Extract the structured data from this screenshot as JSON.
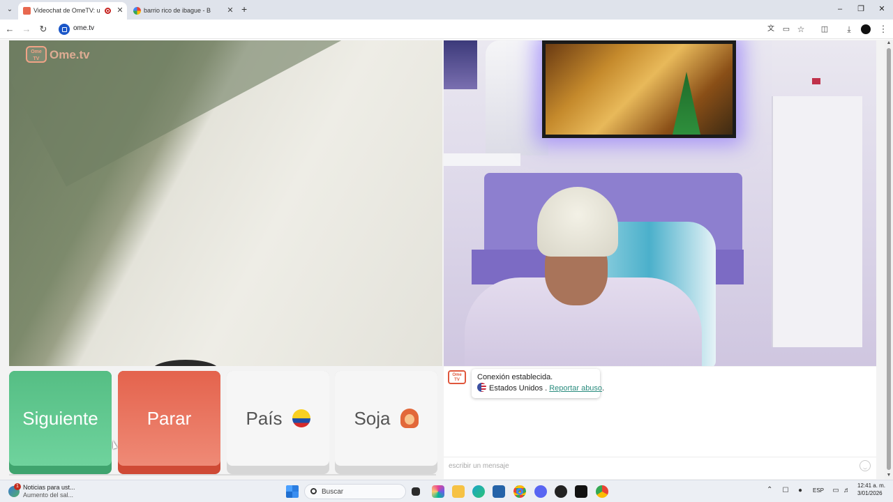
{
  "browser": {
    "tabs": [
      {
        "title": "Videochat de OmeTV: una",
        "active": true
      },
      {
        "title": "barrio rico de ibague - Buscar c",
        "active": false
      }
    ],
    "url": "ome.tv"
  },
  "page": {
    "logo_text": "Ome.tv",
    "logo_badge": "Ome TV",
    "buttons": {
      "next": "Siguiente",
      "stop": "Parar",
      "country": "País",
      "gender": "Soja"
    },
    "chat": {
      "system_icon_text": "Ome TV",
      "connection_status": "Conexión establecida.",
      "partner_country": "Estados Unidos .",
      "report_link": "Reportar abuso",
      "report_suffix": ".",
      "input_placeholder": "escribir un mensaje"
    }
  },
  "taskbar": {
    "news_title": "Noticias para ust...",
    "news_subtitle": "Aumento del sal...",
    "news_badge": "1",
    "search_placeholder": "Buscar",
    "language": "ESP",
    "time": "12:41 a. m.",
    "date": "3/01/2026"
  },
  "colors": {
    "next_button": "#5cc48c",
    "stop_button": "#e5674f",
    "accent_link": "#2a8c7e",
    "logo_orange": "#f1a386"
  },
  "icons": {
    "back": "arrow-left-icon",
    "forward": "arrow-right-icon",
    "reload": "reload-icon",
    "translate": "translate-icon",
    "cast": "cast-icon",
    "bookmark": "star-icon",
    "extensions": "puzzle-icon",
    "download": "download-icon",
    "menu": "kebab-menu-icon",
    "emoji": "smiley-icon"
  }
}
